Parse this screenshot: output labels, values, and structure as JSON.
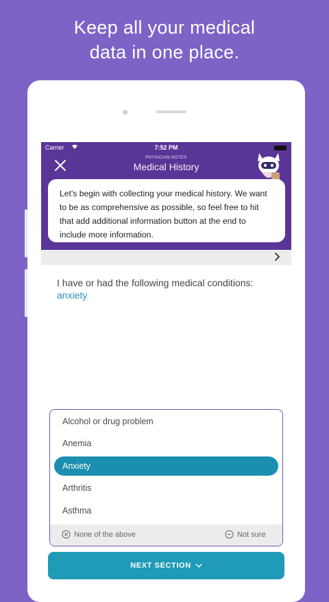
{
  "headline": {
    "line1": "Keep all your medical",
    "line2": "data in one place."
  },
  "status_bar": {
    "carrier": "Carrier",
    "time": "7:52 PM"
  },
  "nav": {
    "subtitle": "PHYSICIAN NOTES",
    "title": "Medical History",
    "close_icon": "close-icon"
  },
  "intro_message": "Let's begin with collecting your medical history. We want to be as comprehensive as possible, so feel free to hit that add additional information button at the end to include more information.",
  "question": {
    "text": "I have or had the following medical conditions:",
    "answer": "anxiety"
  },
  "options": [
    {
      "label": "Alcohol or drug problem",
      "selected": false
    },
    {
      "label": "Anemia",
      "selected": false
    },
    {
      "label": "Anxiety",
      "selected": true
    },
    {
      "label": "Arthritis",
      "selected": false
    },
    {
      "label": "Asthma",
      "selected": false
    }
  ],
  "footer": {
    "none_label": "None of the above",
    "not_sure_label": "Not sure"
  },
  "next_section_label": "NEXT SECTION",
  "colors": {
    "background": "#7d63c6",
    "app_bar": "#5a3598",
    "accent": "#1f9ab7",
    "selected_option": "#1a8fae",
    "answer_text": "#2a8fbd"
  }
}
